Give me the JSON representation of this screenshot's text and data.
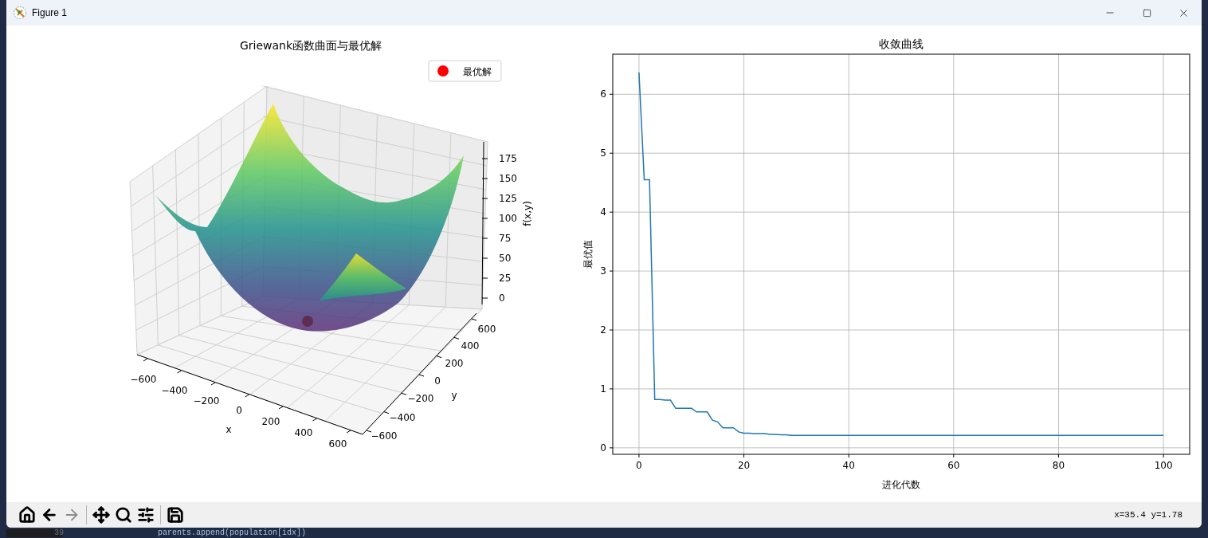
{
  "window": {
    "title": "Figure 1"
  },
  "surface_plot": {
    "title": "Griewank函数曲面与最优解",
    "legend": [
      {
        "label": "最优解",
        "color": "#ff0000"
      }
    ],
    "x_axis": {
      "label": "x",
      "ticks": [
        "−600",
        "−400",
        "−200",
        "0",
        "200",
        "400",
        "600"
      ]
    },
    "y_axis": {
      "label": "y",
      "ticks": [
        "−600",
        "−400",
        "−200",
        "0",
        "200",
        "400",
        "600"
      ]
    },
    "z_axis": {
      "label": "f(x,y)",
      "ticks": [
        "175",
        "150",
        "125",
        "100",
        "75",
        "50",
        "25",
        "0"
      ]
    }
  },
  "convergence_plot": {
    "chart_data": {
      "type": "line",
      "title": "收敛曲线",
      "xlabel": "进化代数",
      "ylabel": "最优值",
      "grid": true,
      "x": [
        0,
        1,
        2,
        3,
        4,
        5,
        6,
        7,
        8,
        9,
        10,
        11,
        12,
        13,
        14,
        15,
        16,
        17,
        18,
        19,
        20,
        21,
        22,
        23,
        24,
        25,
        26,
        27,
        28,
        29,
        30,
        31,
        32,
        33,
        34,
        35,
        36,
        37,
        38,
        39,
        40,
        41,
        42,
        43,
        44,
        45,
        46,
        47,
        48,
        49,
        50,
        51,
        52,
        53,
        54,
        55,
        56,
        57,
        58,
        59,
        60,
        61,
        62,
        63,
        64,
        65,
        66,
        67,
        68,
        69,
        70,
        71,
        72,
        73,
        74,
        75,
        76,
        77,
        78,
        79,
        80,
        81,
        82,
        83,
        84,
        85,
        86,
        87,
        88,
        89,
        90,
        91,
        92,
        93,
        94,
        95,
        96,
        97,
        98,
        99,
        100
      ],
      "xlim": [
        -5,
        105
      ],
      "ylim": [
        -0.11,
        6.68
      ],
      "xticks": [
        0,
        20,
        40,
        60,
        80,
        100
      ],
      "yticks": [
        0,
        1,
        2,
        3,
        4,
        5,
        6
      ],
      "series": [
        {
          "color": "#1f77b4",
          "values": [
            6.37,
            4.55,
            4.55,
            0.82,
            0.82,
            0.81,
            0.81,
            0.67,
            0.67,
            0.67,
            0.67,
            0.61,
            0.61,
            0.61,
            0.47,
            0.44,
            0.34,
            0.34,
            0.34,
            0.27,
            0.25,
            0.25,
            0.24,
            0.24,
            0.24,
            0.23,
            0.23,
            0.22,
            0.22,
            0.21,
            0.21,
            0.21,
            0.21,
            0.21,
            0.21,
            0.21,
            0.21,
            0.21,
            0.21,
            0.21,
            0.21,
            0.21,
            0.21,
            0.21,
            0.21,
            0.21,
            0.21,
            0.21,
            0.21,
            0.21,
            0.21,
            0.21,
            0.21,
            0.21,
            0.21,
            0.21,
            0.21,
            0.21,
            0.21,
            0.21,
            0.21,
            0.21,
            0.21,
            0.21,
            0.21,
            0.21,
            0.21,
            0.21,
            0.21,
            0.21,
            0.21,
            0.21,
            0.21,
            0.21,
            0.21,
            0.21,
            0.21,
            0.21,
            0.21,
            0.21,
            0.21,
            0.21,
            0.21,
            0.21,
            0.21,
            0.21,
            0.21,
            0.21,
            0.21,
            0.21,
            0.21,
            0.21,
            0.21,
            0.21,
            0.21,
            0.21,
            0.21,
            0.21,
            0.21,
            0.21,
            0.21
          ]
        }
      ]
    }
  },
  "toolbar": {
    "tools": [
      {
        "kind": "home",
        "disabled": false
      },
      {
        "kind": "back",
        "disabled": false
      },
      {
        "kind": "forward",
        "disabled": true
      },
      {
        "kind": "pan",
        "disabled": false
      },
      {
        "kind": "zoom",
        "disabled": false
      },
      {
        "kind": "configure",
        "disabled": false
      },
      {
        "kind": "save",
        "disabled": false
      }
    ],
    "coordinates": "x=35.4 y=1.78"
  },
  "editor_peek": {
    "line_number": "39",
    "code": "parents.append(population[idx])"
  }
}
